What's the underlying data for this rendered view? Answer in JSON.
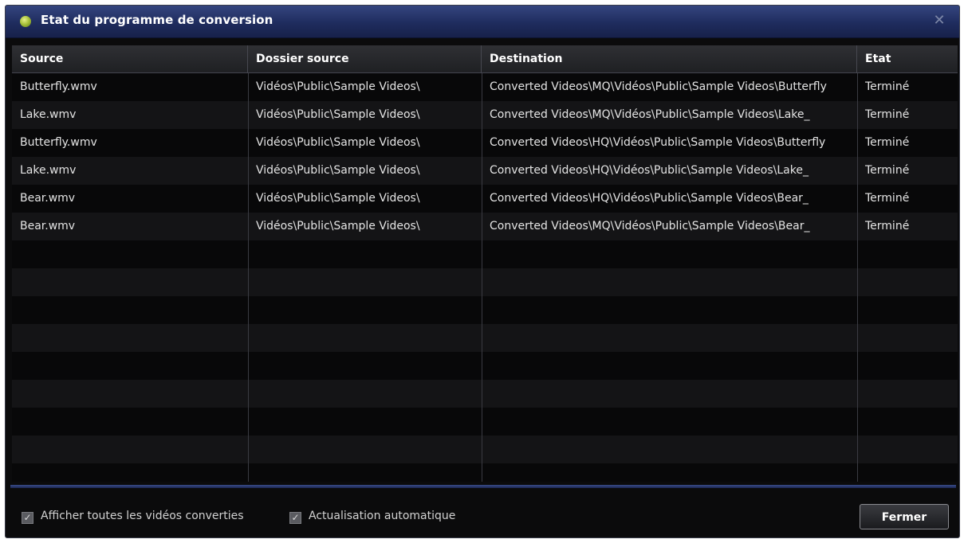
{
  "window": {
    "title": "Etat du programme de conversion",
    "close_glyph": "✕",
    "icon": "status-orb-icon"
  },
  "table": {
    "columns": [
      "Source",
      "Dossier source",
      "Destination",
      "Etat"
    ],
    "rows": [
      [
        "Butterfly.wmv",
        "Vidéos\\Public\\Sample Videos\\",
        "Converted Videos\\MQ\\Vidéos\\Public\\Sample Videos\\Butterfly",
        "Terminé"
      ],
      [
        "Lake.wmv",
        "Vidéos\\Public\\Sample Videos\\",
        "Converted Videos\\MQ\\Vidéos\\Public\\Sample Videos\\Lake_",
        "Terminé"
      ],
      [
        "Butterfly.wmv",
        "Vidéos\\Public\\Sample Videos\\",
        "Converted Videos\\HQ\\Vidéos\\Public\\Sample Videos\\Butterfly",
        "Terminé"
      ],
      [
        "Lake.wmv",
        "Vidéos\\Public\\Sample Videos\\",
        "Converted Videos\\HQ\\Vidéos\\Public\\Sample Videos\\Lake_",
        "Terminé"
      ],
      [
        "Bear.wmv",
        "Vidéos\\Public\\Sample Videos\\",
        "Converted Videos\\HQ\\Vidéos\\Public\\Sample Videos\\Bear_",
        "Terminé"
      ],
      [
        "Bear.wmv",
        "Vidéos\\Public\\Sample Videos\\",
        "Converted Videos\\MQ\\Vidéos\\Public\\Sample Videos\\Bear_",
        "Terminé"
      ]
    ]
  },
  "footer": {
    "show_all_label": "Afficher toutes les vidéos converties",
    "show_all_checked": true,
    "auto_refresh_label": "Actualisation automatique",
    "auto_refresh_checked": true,
    "close_button_label": "Fermer"
  },
  "colors": {
    "titlebar": "#1f2c5e",
    "background": "#0b0b0c",
    "text": "#e4e4e4"
  }
}
